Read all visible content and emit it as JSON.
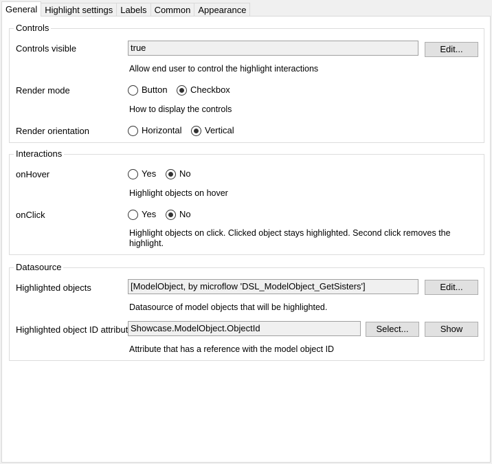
{
  "tabs": [
    "General",
    "Highlight settings",
    "Labels",
    "Common",
    "Appearance"
  ],
  "controls": {
    "title": "Controls",
    "controls_visible": {
      "label": "Controls visible",
      "value": "true",
      "button": "Edit...",
      "hint": "Allow end user to control the highlight interactions"
    },
    "render_mode": {
      "label": "Render mode",
      "options": [
        "Button",
        "Checkbox"
      ],
      "selected": "Checkbox",
      "hint": "How to display the controls"
    },
    "render_orientation": {
      "label": "Render orientation",
      "options": [
        "Horizontal",
        "Vertical"
      ],
      "selected": "Vertical"
    }
  },
  "interactions": {
    "title": "Interactions",
    "on_hover": {
      "label": "onHover",
      "options": [
        "Yes",
        "No"
      ],
      "selected": "No",
      "hint": "Highlight objects on hover"
    },
    "on_click": {
      "label": "onClick",
      "options": [
        "Yes",
        "No"
      ],
      "selected": "No",
      "hint": "Highlight objects on click. Clicked object stays highlighted. Second click removes the highlight."
    }
  },
  "datasource": {
    "title": "Datasource",
    "highlighted_objects": {
      "label": "Highlighted objects",
      "value": "[ModelObject, by microflow 'DSL_ModelObject_GetSisters']",
      "button": "Edit...",
      "hint": "Datasource of model objects that will be highlighted."
    },
    "object_id_attribute": {
      "label": "Highlighted object ID attribute",
      "value": "Showcase.ModelObject.ObjectId",
      "select_button": "Select...",
      "show_button": "Show",
      "hint": "Attribute that has a reference with the model object ID"
    }
  }
}
